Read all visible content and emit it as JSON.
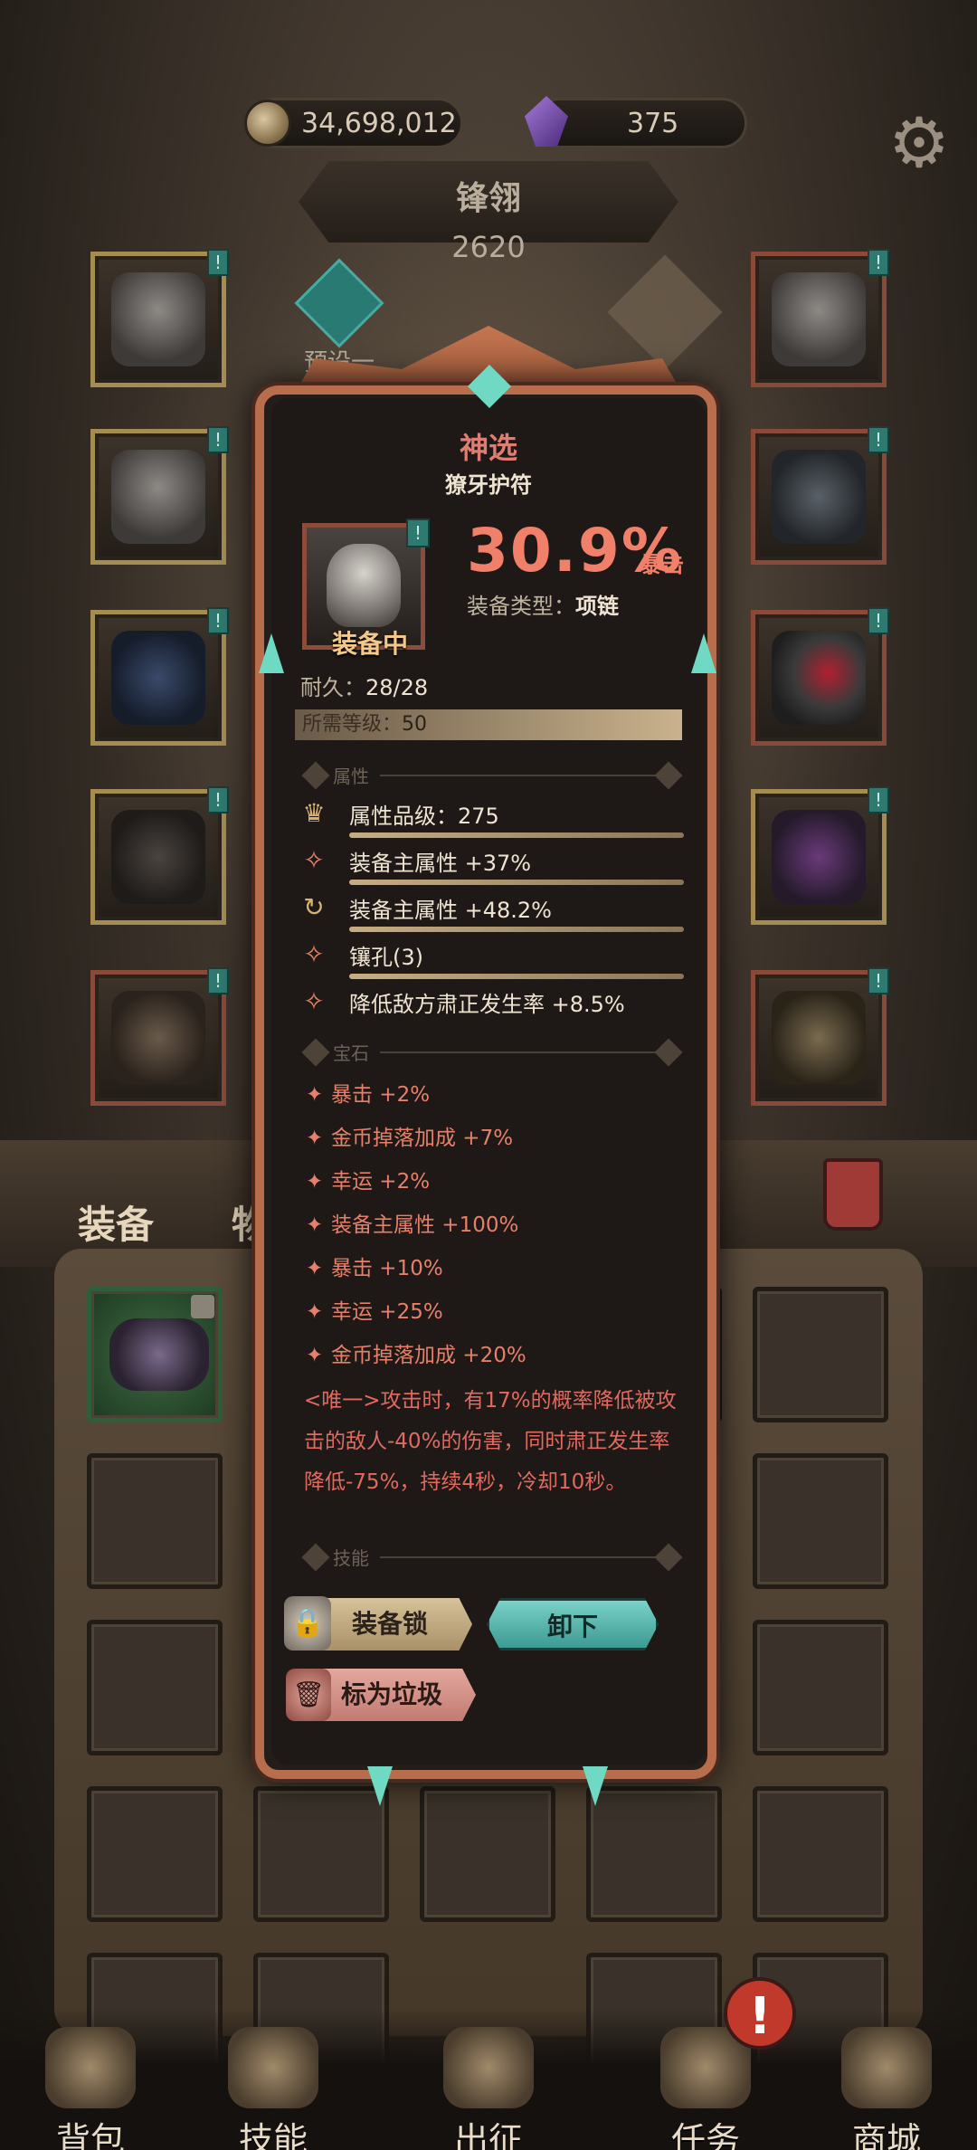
{
  "currency": {
    "gold": "34,698,012",
    "gems": "375"
  },
  "hero": {
    "name": "锋翎",
    "power": "2620"
  },
  "preset": {
    "label": "预设一"
  },
  "tabs": {
    "equipment": "装备",
    "items": "物品"
  },
  "tooltip": {
    "quality": "神选",
    "item_name": "獠牙护符",
    "equipped_label": "装备中",
    "main_value": "30.9%",
    "main_stat": "暴击",
    "type_label": "装备类型：",
    "type_value": "项链",
    "durability_label": "耐久：",
    "durability_value": "28/28",
    "req_label": "所需等级：",
    "req_value": "50",
    "section_attr": "属性",
    "attributes": [
      {
        "icon": "crown-icon",
        "text": "属性品级：275"
      },
      {
        "icon": "spark-icon",
        "text": "装备主属性 +37%"
      },
      {
        "icon": "refresh-icon",
        "text": "装备主属性 +48.2%"
      },
      {
        "icon": "spark-icon",
        "text": "镶孔(3)"
      },
      {
        "icon": "spark-icon",
        "text": "降低敌方肃正发生率 +8.5%"
      }
    ],
    "section_gem": "宝石",
    "gems": [
      "暴击 +2%",
      "金币掉落加成 +7%",
      "幸运 +2%",
      "装备主属性 +100%",
      "暴击 +10%",
      "幸运 +25%",
      "金币掉落加成 +20%"
    ],
    "unique_text": "<唯一>攻击时，有17%的概率降低被攻击的敌人-40%的伤害，同时肃正发生率降低-75%，持续4秒，冷却10秒。",
    "section_skill": "技能",
    "btn_lock": "装备锁",
    "btn_unequip": "卸下",
    "btn_trash": "标为垃圾"
  },
  "nav": {
    "bag": "背包",
    "skill": "技能",
    "expedition": "出征",
    "quest": "任务",
    "shop": "商城",
    "quest_alert": "!"
  },
  "colors": {
    "quality": "#e07d72",
    "accent_teal": "#6fd9c4",
    "frame": "#b86e4c"
  }
}
